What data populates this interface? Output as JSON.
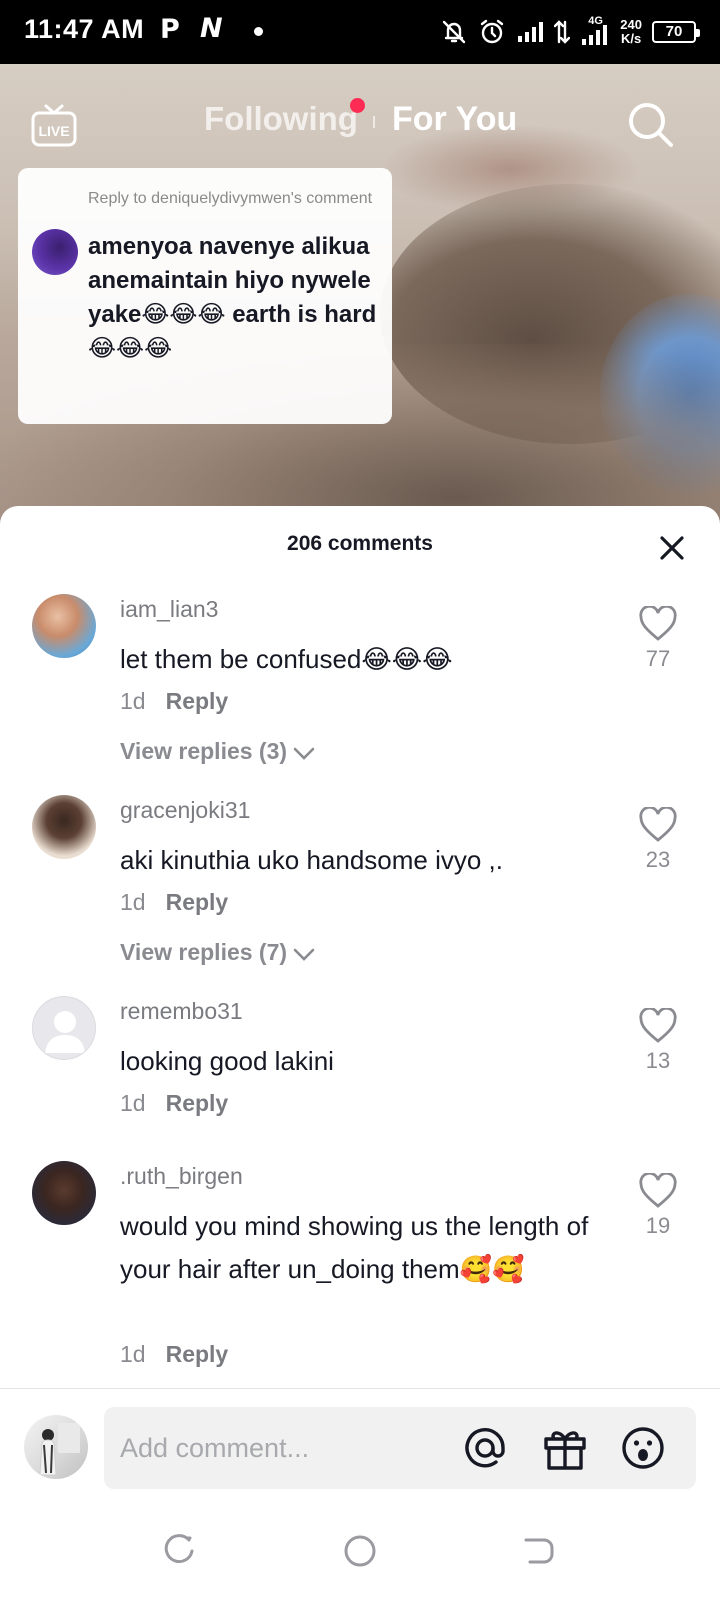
{
  "status_bar": {
    "time": "11:47 AM",
    "p_indicator": "P",
    "n_indicator": "N",
    "network": "4G",
    "speed_value": "240",
    "speed_unit": "K/s",
    "battery": "70"
  },
  "top_nav": {
    "live_label": "LIVE",
    "following": "Following",
    "for_you": "For You",
    "icons": [
      "live-icon",
      "search-icon"
    ]
  },
  "reply_card": {
    "header": "Reply to deniquelydivymwen's comment",
    "text": "amenyoa navenye alikua anemaintain hiyo nywele yake😂😂😂 earth is hard 😂😂😂"
  },
  "comments_sheet": {
    "title": "206 comments",
    "close_icon": "close-icon",
    "comments": [
      {
        "user": "iam_lian3",
        "text": "let them be confused😂😂😂",
        "age": "1d",
        "reply": "Reply",
        "likes": "77",
        "replies": "View replies (3)"
      },
      {
        "user": "gracenjoki31",
        "text": "aki kinuthia uko handsome ivyo ,.",
        "age": "1d",
        "reply": "Reply",
        "likes": "23",
        "replies": "View replies (7)"
      },
      {
        "user": "remembo31",
        "text": "looking good lakini",
        "age": "1d",
        "reply": "Reply",
        "likes": "13"
      },
      {
        "user": ".ruth_birgen",
        "text": "would you mind showing us the length of your hair after un_doing them🥰🥰",
        "age": "1d",
        "reply": "Reply",
        "likes": "19"
      }
    ]
  },
  "composer": {
    "placeholder": "Add comment...",
    "icons": [
      "mention-icon",
      "gift-icon",
      "emoji-icon"
    ]
  },
  "nav_bar": {
    "icons": [
      "recents-icon",
      "home-icon",
      "back-icon"
    ]
  },
  "colors": {
    "accent": "#fe2c55",
    "text_primary": "#161823",
    "text_secondary": "#8a8b91"
  }
}
